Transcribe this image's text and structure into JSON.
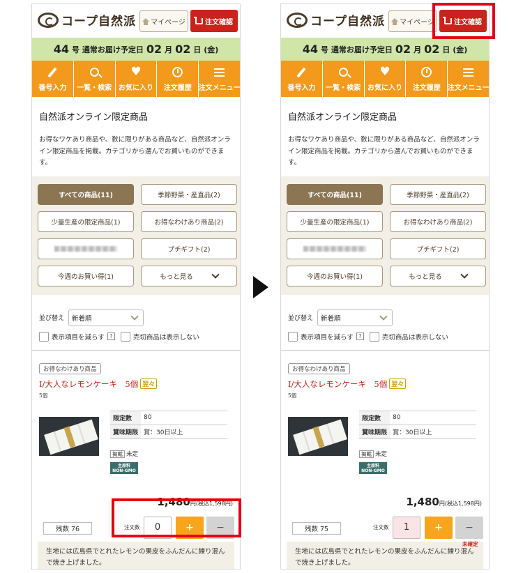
{
  "header": {
    "logo_text": "コープ自然派",
    "mypage_label": "マイページ",
    "order_confirm_label": "注文確認"
  },
  "delivery": {
    "issue_num": "44",
    "issue_suffix": "号 通常お届け予定日",
    "month": "02",
    "month_suffix": "月",
    "day": "02",
    "day_suffix": "日 (金)"
  },
  "nav": {
    "items": [
      {
        "label": "番号入力",
        "icon": "pencil-icon"
      },
      {
        "label": "一覧・検索",
        "icon": "search-icon"
      },
      {
        "label": "お気に入り",
        "icon": "heart-icon"
      },
      {
        "label": "注文履歴",
        "icon": "clock-icon"
      },
      {
        "label": "注文メニュー",
        "icon": "menu-icon"
      }
    ]
  },
  "intro": {
    "title": "自然派オンライン限定商品",
    "text": "お得なワケあり商品や、数に限りがある商品など、自然派オンライン限定商品を掲載。カテゴリから選んでお買いものができます。"
  },
  "categories": [
    "すべての商品(11)",
    "季節野菜・産直品(2)",
    "少量生産の限定商品(1)",
    "お得なわけあり商品(2)",
    "",
    "プチギフト(2)",
    "今週のお買い得(1)",
    "もっと見る"
  ],
  "sort": {
    "label": "並び替え",
    "value": "新着順",
    "reduce_items": "表示項目を減らす",
    "help": "?",
    "hide_soldout": "売切商品は表示しない"
  },
  "product": {
    "tag": "お得なわけあり商品",
    "name": "I/大人なレモンケーキ　5個",
    "badge": "翌々",
    "sub": "5個",
    "spec": [
      {
        "k": "限定数",
        "v": "80"
      },
      {
        "k": "賞味期限",
        "v": "賞：30日以上"
      }
    ],
    "keisai_label": "掲載",
    "keisai_value": "未定",
    "gmo_line1": "主原料",
    "gmo_line2": "NON-GMO",
    "price": "1,480",
    "price_unit": "円(税込1,598円)",
    "qty_label": "注文数",
    "plus": "+",
    "minus": "−",
    "description": "生地には広島県でとれたレモンの果皮をふんだんに練り混んで焼き上げました。"
  },
  "left": {
    "stock": "残数 76",
    "qty": "0"
  },
  "right": {
    "stock": "残数 75",
    "qty": "1",
    "status": "未確定"
  }
}
